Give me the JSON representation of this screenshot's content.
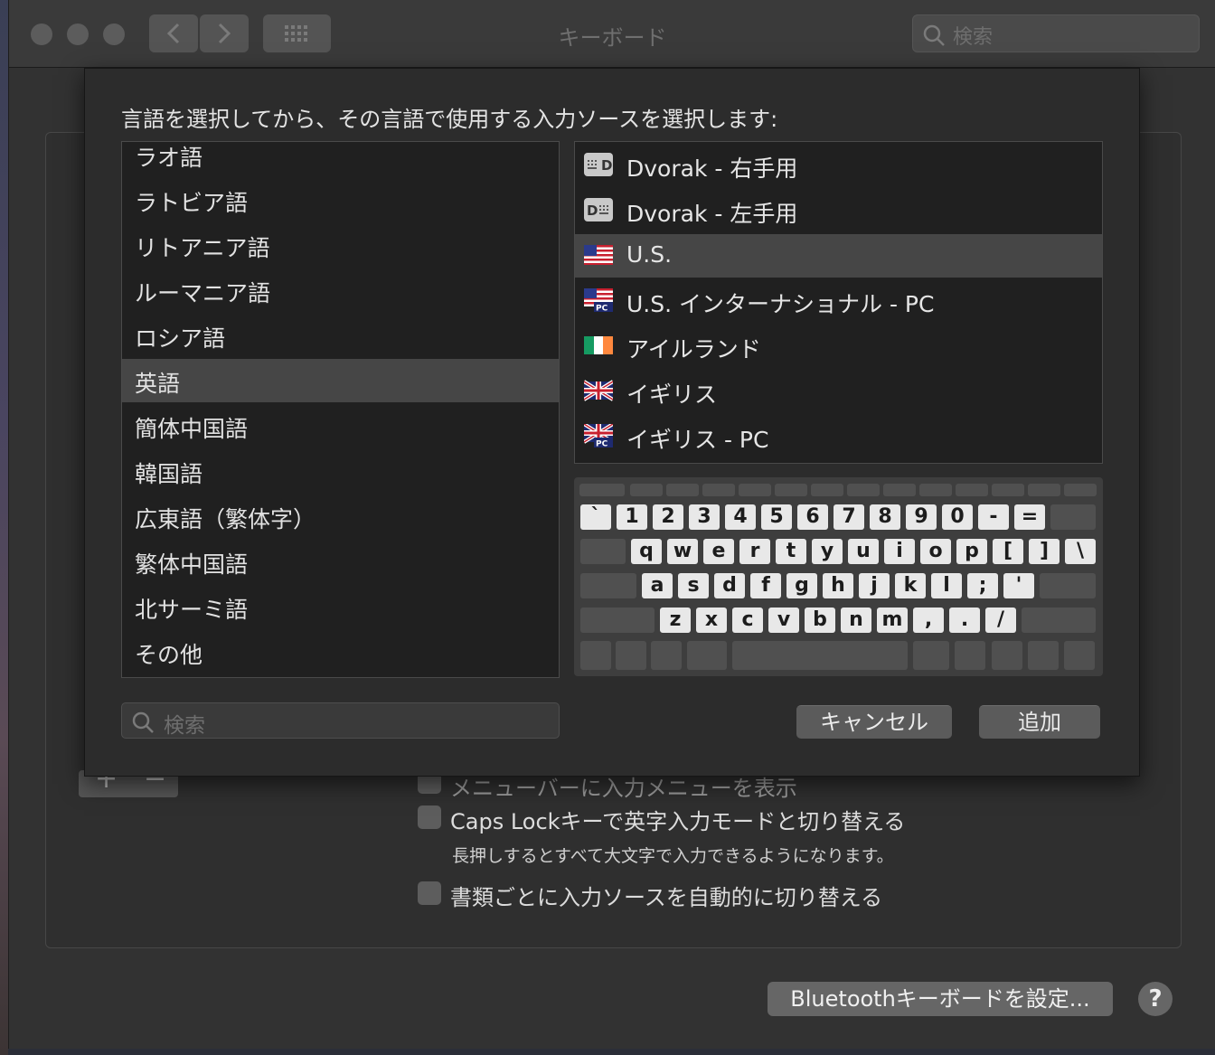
{
  "window": {
    "title": "キーボード"
  },
  "toolbar": {
    "search_placeholder": "検索"
  },
  "sheet": {
    "prompt": "言語を選択してから、その言語で使用する入力ソースを選択します:",
    "languages": [
      "ラオ語",
      "ラトビア語",
      "リトアニア語",
      "ルーマニア語",
      "ロシア語",
      "英語",
      "簡体中国語",
      "韓国語",
      "広東語（繁体字）",
      "繁体中国語",
      "北サーミ語",
      "その他"
    ],
    "selected_language": "英語",
    "sources": [
      {
        "label": "Dvorak - 右手用",
        "icon": "dvorak-right-icon"
      },
      {
        "label": "Dvorak - 左手用",
        "icon": "dvorak-left-icon"
      },
      {
        "label": "U.S.",
        "icon": "us-flag-icon"
      },
      {
        "label": "U.S. インターナショナル - PC",
        "icon": "us-pc-flag-icon"
      },
      {
        "label": "アイルランド",
        "icon": "ireland-flag-icon"
      },
      {
        "label": "イギリス",
        "icon": "uk-flag-icon"
      },
      {
        "label": "イギリス - PC",
        "icon": "uk-pc-flag-icon"
      }
    ],
    "selected_source": "U.S.",
    "keyboard": {
      "row1": [
        "`",
        "1",
        "2",
        "3",
        "4",
        "5",
        "6",
        "7",
        "8",
        "9",
        "0",
        "-",
        "="
      ],
      "row2": [
        "q",
        "w",
        "e",
        "r",
        "t",
        "y",
        "u",
        "i",
        "o",
        "p",
        "[",
        "]",
        "\\"
      ],
      "row3": [
        "a",
        "s",
        "d",
        "f",
        "g",
        "h",
        "j",
        "k",
        "l",
        ";",
        "'"
      ],
      "row4": [
        "z",
        "x",
        "c",
        "v",
        "b",
        "n",
        "m",
        ",",
        ".",
        "/"
      ]
    },
    "search_placeholder": "検索",
    "cancel_label": "キャンセル",
    "add_label": "追加"
  },
  "background": {
    "show_menu_label": "メニューバーに入力メニューを表示",
    "capslock_label": "Caps Lockキーで英字入力モードと切り替える",
    "capslock_hint": "長押しするとすべて大文字で入力できるようになります。",
    "auto_switch_label": "書類ごとに入力ソースを自動的に切り替える",
    "bluetooth_label": "Bluetoothキーボードを設定...",
    "help_label": "?",
    "plus_label": "+",
    "minus_label": "−"
  },
  "colors": {
    "selection": "#464646",
    "list_bg": "#202020",
    "sheet_bg": "#2c2c2c"
  }
}
